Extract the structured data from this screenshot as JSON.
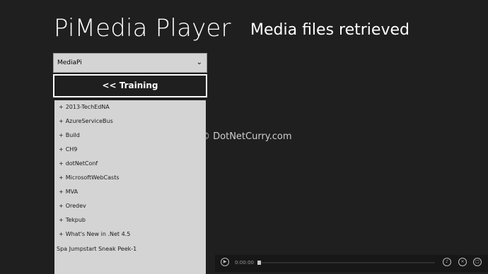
{
  "header": {
    "app_title": "PiMedia Player",
    "status": "Media files retrieved"
  },
  "source_select": {
    "selected": "MediaPi"
  },
  "back_button": {
    "label": "<< Training"
  },
  "folders": [
    {
      "label": "2013-TechEdNA",
      "expandable": true
    },
    {
      "label": "AzureServiceBus",
      "expandable": true
    },
    {
      "label": "Build",
      "expandable": true
    },
    {
      "label": "CH9",
      "expandable": true
    },
    {
      "label": "dotNetConf",
      "expandable": true
    },
    {
      "label": "MicrosoftWebCasts",
      "expandable": true
    },
    {
      "label": "MVA",
      "expandable": true
    },
    {
      "label": "Oredev",
      "expandable": true
    },
    {
      "label": "Tekpub",
      "expandable": true
    },
    {
      "label": "What's New in .Net 4.5",
      "expandable": true
    },
    {
      "label": "Spa Jumpstart Sneak Peek-1",
      "expandable": false
    }
  ],
  "watermark": "© DotNetCurry.com",
  "player": {
    "time": "0:00:00",
    "icons": [
      "play-icon",
      "volume-icon",
      "close-icon",
      "fullscreen-icon"
    ]
  },
  "colors": {
    "background": "#1f1f1f",
    "list_background": "#d4d4d4",
    "player_bar": "#171717"
  }
}
